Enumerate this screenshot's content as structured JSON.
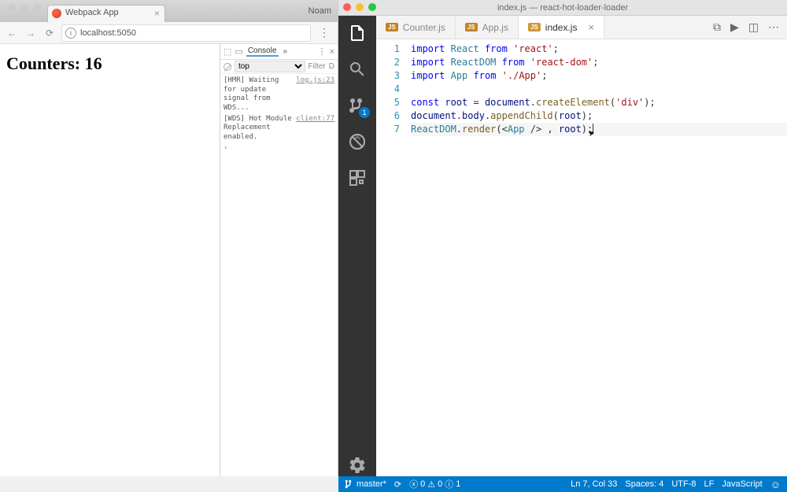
{
  "chrome": {
    "tab_title": "Webpack App",
    "user_name": "Noam",
    "url": "localhost:5050",
    "page_heading": "Counters: 16",
    "devtools": {
      "active_tab": "Console",
      "context": "top",
      "filter_label": "Filter",
      "default_label": "D",
      "logs": [
        {
          "msg": "[HMR] Waiting for update signal from WDS...",
          "src": "log.js:23"
        },
        {
          "msg": "[WDS] Hot Module Replacement enabled.",
          "src": "client:77"
        }
      ]
    }
  },
  "vscode": {
    "title": "index.js — react-hot-loader-loader",
    "activity_badge": "1",
    "tabs": [
      {
        "label": "Counter.js",
        "active": false
      },
      {
        "label": "App.js",
        "active": false
      },
      {
        "label": "index.js",
        "active": true
      }
    ],
    "code_lines": [
      {
        "n": 1,
        "tokens": [
          [
            "kw",
            "import"
          ],
          [
            "",
            " "
          ],
          [
            "id",
            "React"
          ],
          [
            "",
            " "
          ],
          [
            "from",
            "from"
          ],
          [
            "",
            " "
          ],
          [
            "str",
            "'react'"
          ],
          [
            "",
            ";"
          ]
        ]
      },
      {
        "n": 2,
        "tokens": [
          [
            "kw",
            "import"
          ],
          [
            "",
            " "
          ],
          [
            "id",
            "ReactDOM"
          ],
          [
            "",
            " "
          ],
          [
            "from",
            "from"
          ],
          [
            "",
            " "
          ],
          [
            "str",
            "'react-dom'"
          ],
          [
            "",
            ";"
          ]
        ]
      },
      {
        "n": 3,
        "tokens": [
          [
            "kw",
            "import"
          ],
          [
            "",
            " "
          ],
          [
            "id",
            "App"
          ],
          [
            "",
            " "
          ],
          [
            "from",
            "from"
          ],
          [
            "",
            " "
          ],
          [
            "str",
            "'./App'"
          ],
          [
            "",
            ";"
          ]
        ]
      },
      {
        "n": 4,
        "tokens": []
      },
      {
        "n": 5,
        "tokens": [
          [
            "kw",
            "const"
          ],
          [
            "",
            " "
          ],
          [
            "var",
            "root"
          ],
          [
            "",
            " = "
          ],
          [
            "var",
            "document"
          ],
          [
            "",
            "."
          ],
          [
            "fn",
            "createElement"
          ],
          [
            "",
            "("
          ],
          [
            "str",
            "'div'"
          ],
          [
            "",
            ");"
          ]
        ]
      },
      {
        "n": 6,
        "tokens": [
          [
            "var",
            "document"
          ],
          [
            "",
            "."
          ],
          [
            "var",
            "body"
          ],
          [
            "",
            "."
          ],
          [
            "fn",
            "appendChild"
          ],
          [
            "",
            "("
          ],
          [
            "var",
            "root"
          ],
          [
            "",
            ");"
          ]
        ]
      },
      {
        "n": 7,
        "tokens": [
          [
            "id",
            "ReactDOM"
          ],
          [
            "",
            "."
          ],
          [
            "fn",
            "render"
          ],
          [
            "",
            "(<"
          ],
          [
            "id",
            "App"
          ],
          [
            "",
            " /> , "
          ],
          [
            "var",
            "root"
          ],
          [
            "",
            ");"
          ]
        ]
      }
    ],
    "status": {
      "branch": "master*",
      "sync": "⟳",
      "errors": "0",
      "warnings": "0",
      "info": "1",
      "cursor": "Ln 7, Col 33",
      "spaces": "Spaces: 4",
      "encoding": "UTF-8",
      "eol": "LF",
      "language": "JavaScript"
    }
  }
}
